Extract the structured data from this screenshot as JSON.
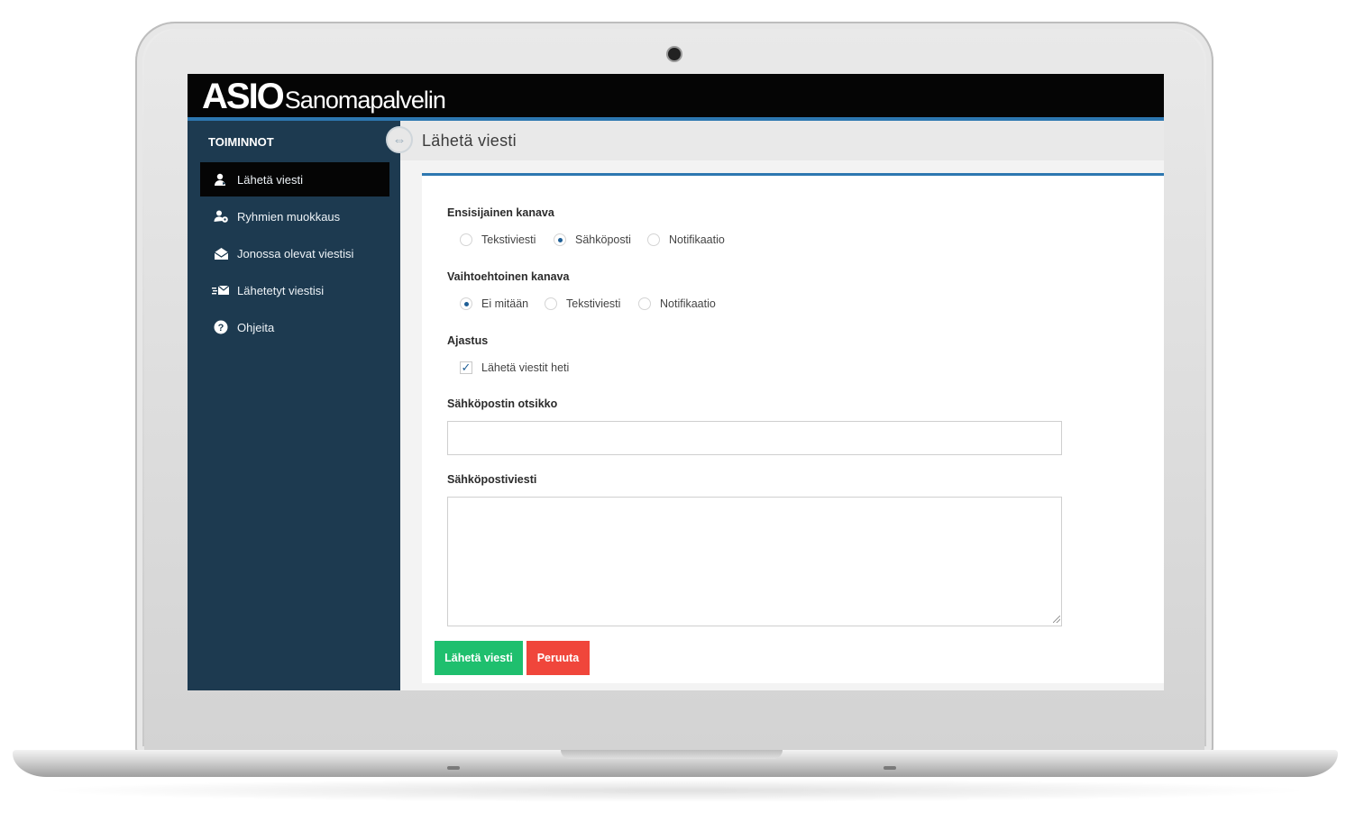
{
  "header": {
    "brand": "ASIO",
    "service": "Sanomapalvelin"
  },
  "sidebar": {
    "title": "TOIMINNOT",
    "items": [
      {
        "label": "Lähetä viesti",
        "icon": "user-send-icon",
        "active": true
      },
      {
        "label": "Ryhmien muokkaus",
        "icon": "group-edit-icon",
        "active": false
      },
      {
        "label": "Jonossa olevat viestisi",
        "icon": "envelope-open-icon",
        "active": false
      },
      {
        "label": "Lähetetyt viestisi",
        "icon": "sent-mail-icon",
        "active": false
      },
      {
        "label": "Ohjeita",
        "icon": "help-icon",
        "active": false
      }
    ]
  },
  "page": {
    "title": "Lähetä viesti"
  },
  "form": {
    "primary_channel": {
      "label": "Ensisijainen kanava",
      "options": [
        "Tekstiviesti",
        "Sähköposti",
        "Notifikaatio"
      ],
      "selected": "Sähköposti"
    },
    "alternative_channel": {
      "label": "Vaihtoehtoinen kanava",
      "options": [
        "Ei mitään",
        "Tekstiviesti",
        "Notifikaatio"
      ],
      "selected": "Ei mitään"
    },
    "schedule": {
      "label": "Ajastus",
      "checkbox_label": "Lähetä viestit heti",
      "checked": true
    },
    "email_subject": {
      "label": "Sähköpostin otsikko",
      "value": ""
    },
    "email_message": {
      "label": "Sähköpostiviesti",
      "value": ""
    },
    "send_label": "Lähetä viesti",
    "cancel_label": "Peruuta"
  },
  "colors": {
    "accent": "#2d77b0",
    "sidebar": "#1d3a50",
    "send": "#1fbf6e",
    "cancel": "#f0463b"
  }
}
